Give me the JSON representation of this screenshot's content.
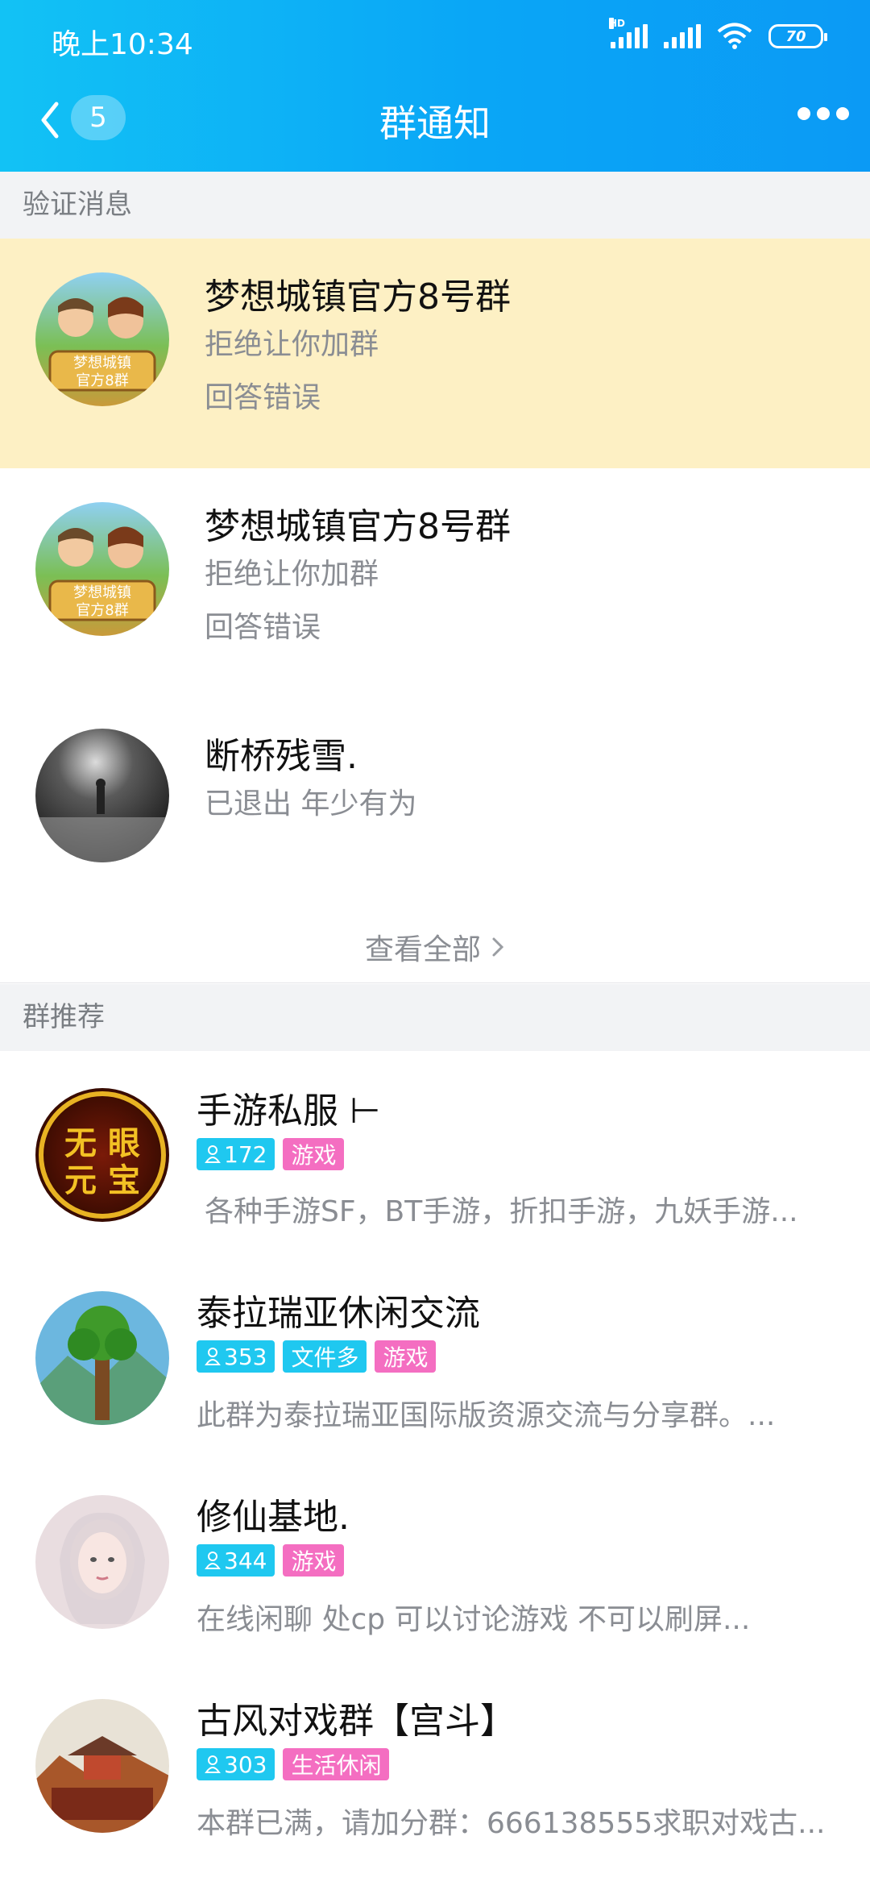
{
  "status_bar": {
    "time": "晚上10:34",
    "battery": "70",
    "hd_label": "HD"
  },
  "nav": {
    "back_count": "5",
    "title": "群通知"
  },
  "sections": {
    "verify": "验证消息",
    "recommend": "群推荐"
  },
  "notices": [
    {
      "name": "梦想城镇官方8号群",
      "line1": "拒绝让你加群",
      "line2": "回答错误",
      "highlighted": true
    },
    {
      "name": "梦想城镇官方8号群",
      "line1": "拒绝让你加群",
      "line2": "回答错误",
      "highlighted": false
    },
    {
      "name": "断桥残雪.",
      "line1": "已退出 年少有为",
      "highlighted": false
    }
  ],
  "avatar_text": {
    "game_line1": "梦想城镇",
    "game_line2": "官方8群",
    "shou_line1": "无 眼",
    "shou_line2": "元 宝"
  },
  "view_all": "查看全部",
  "recommend": [
    {
      "name": "手游私服 ⊢",
      "members": "172",
      "tags": [
        "游戏"
      ],
      "desc": "各种手游SF，BT手游，折扣手游，九妖手游..."
    },
    {
      "name": "泰拉瑞亚休闲交流",
      "members": "353",
      "tags": [
        "文件多",
        "游戏"
      ],
      "desc": "此群为泰拉瑞亚国际版资源交流与分享群。..."
    },
    {
      "name": "修仙基地.",
      "members": "344",
      "tags": [
        "游戏"
      ],
      "desc": "在线闲聊  处cp  可以讨论游戏  不可以刷屏..."
    },
    {
      "name": "古风对戏群【宫斗】",
      "members": "303",
      "tags": [
        "生活休闲"
      ],
      "desc": "本群已满，请加分群：666138555求职对戏古..."
    }
  ],
  "colors": {
    "header": "#0ba6f6",
    "highlight": "#fdf0c4",
    "tag_blue": "#1fc8f0",
    "tag_pink": "#f46ec1"
  }
}
